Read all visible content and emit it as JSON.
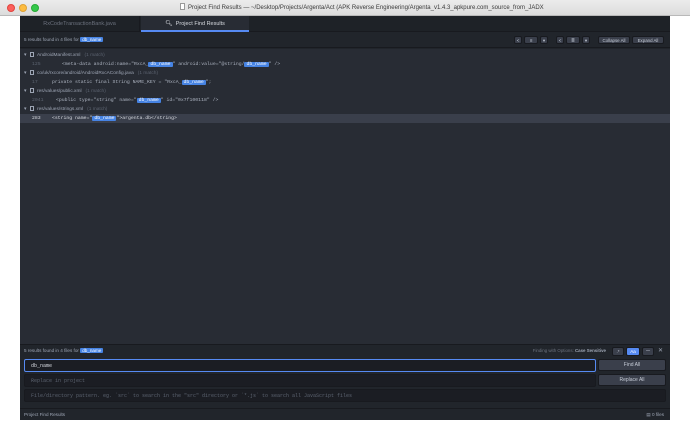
{
  "window": {
    "title": "Project Find Results — ~/Desktop/Projects/Argenta/Act (APK Reverse Engineering/Argenta_v1.4.3_apkpure.com_source_from_JADX"
  },
  "tabs": [
    {
      "label": "RxCodeTransactionBank.java",
      "active": false
    },
    {
      "label": "Project Find Results",
      "active": true,
      "icon": "search-icon"
    }
  ],
  "results_header": {
    "summary_prefix": "5 results found in 4 files for",
    "query": "db_name",
    "buttons": [
      "<",
      "≡",
      "▾",
      "<",
      "≣",
      "▾",
      "Collapse All",
      "Expand All"
    ]
  },
  "results": [
    {
      "type": "file",
      "path": "AndroidManifest.xml",
      "count": "(1 match)"
    },
    {
      "type": "match",
      "line": "125",
      "before": "<meta-data android:name=\"RxcA_",
      "hit": "db_name",
      "after": "\" android:value=\"@string/",
      "hit2": "db_name",
      "after2": "\" />"
    },
    {
      "type": "file",
      "path": "co/uk/rxcore/android/AndroidRxcAConfig.java",
      "count": "(1 match)"
    },
    {
      "type": "match",
      "line": "17",
      "before": "private static final String NAME_KEY = \"RxcA_",
      "hit": "db_name",
      "after": "\";"
    },
    {
      "type": "file",
      "path": "res/values/public.xml",
      "count": "(1 match)"
    },
    {
      "type": "match",
      "line": "2041",
      "before": "<public type=\"string\" name=\"",
      "hit": "db_name",
      "after": "\" id=\"0x7f100118\" />"
    },
    {
      "type": "file",
      "path": "res/values/strings.xml",
      "count": "(1 match)"
    },
    {
      "type": "match",
      "line": "283",
      "before": "<string name=\"",
      "hit": "db_name",
      "after": "\">argenta.db</string>",
      "selected": true
    }
  ],
  "find_panel": {
    "summary_prefix": "5 results found in 4 files for",
    "query": "db_name",
    "options_text": "Finding with Options:",
    "options_value": "Case Sensitive",
    "option_buttons": [
      ".*",
      "Aa",
      "\"\""
    ],
    "find_value": "db_name",
    "replace_placeholder": "Replace in project",
    "paths_placeholder": "File/directory pattern. eg. `src` to search in the \"src\" directory or `*.js` to search all JavaScript files",
    "find_all": "Find All",
    "replace_all": "Replace All"
  },
  "status": {
    "left": "Project Find Results",
    "right": "0 files"
  },
  "colors": {
    "accent": "#568af2",
    "highlight": "#4683e3",
    "background": "#282c34"
  }
}
